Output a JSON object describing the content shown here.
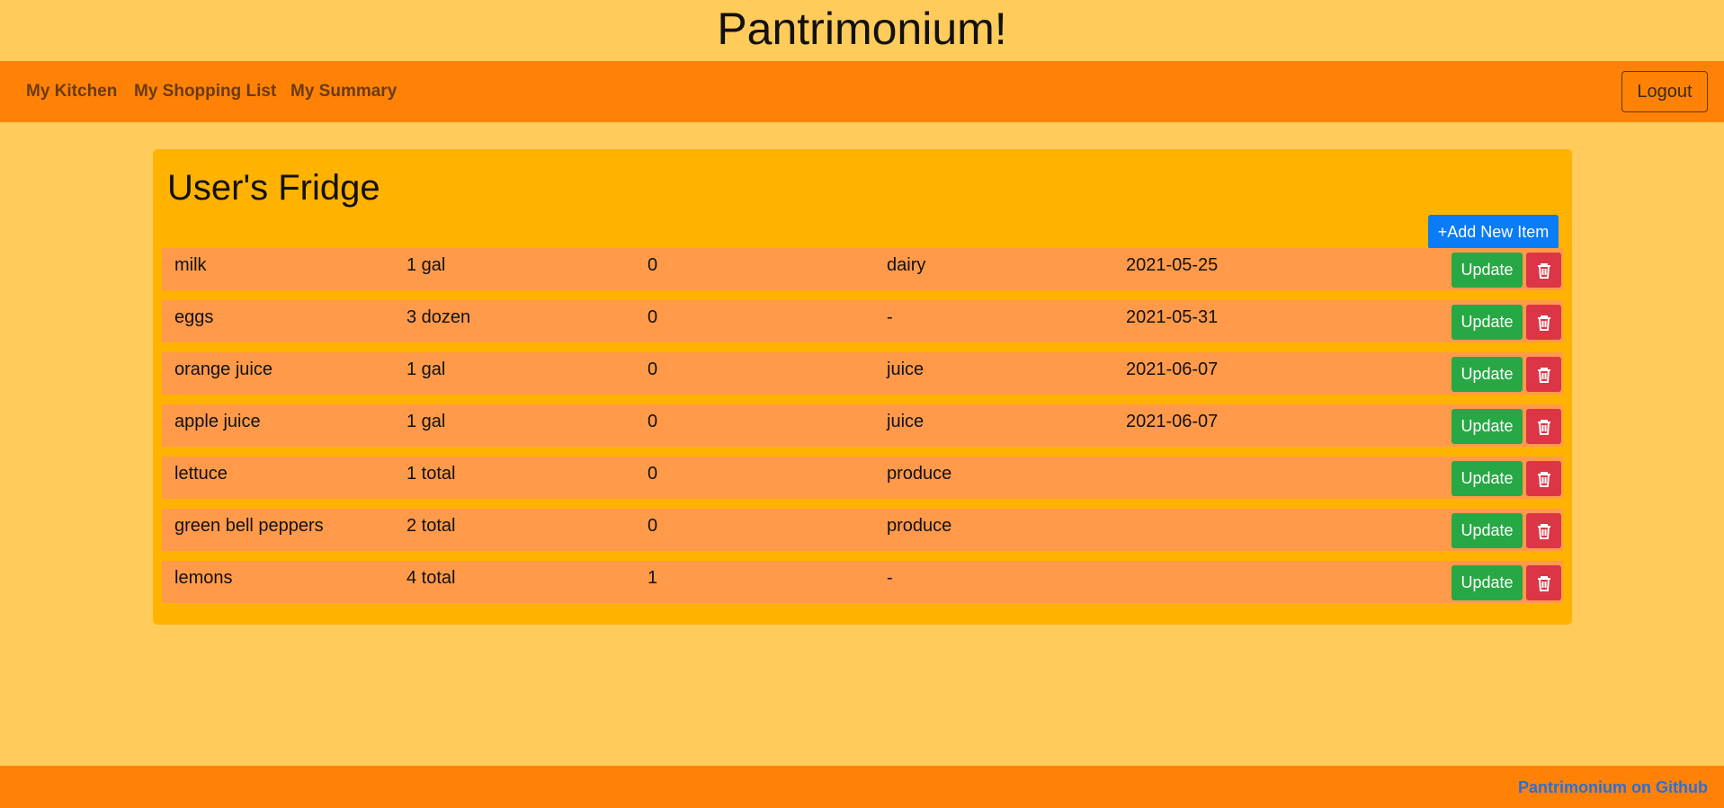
{
  "header": {
    "title": "Pantrimonium!"
  },
  "nav": {
    "links": [
      "My Kitchen",
      "My Shopping List",
      "My Summary"
    ],
    "logout_label": "Logout"
  },
  "fridge": {
    "title": "User's Fridge",
    "add_label": "+Add New Item",
    "update_label": "Update",
    "rows": [
      {
        "name": "milk",
        "quantity": "1 gal",
        "count": "0",
        "category": "dairy",
        "expires": "2021-05-25"
      },
      {
        "name": "eggs",
        "quantity": "3 dozen",
        "count": "0",
        "category": "-",
        "expires": "2021-05-31"
      },
      {
        "name": "orange juice",
        "quantity": "1 gal",
        "count": "0",
        "category": "juice",
        "expires": "2021-06-07"
      },
      {
        "name": "apple juice",
        "quantity": "1 gal",
        "count": "0",
        "category": "juice",
        "expires": "2021-06-07"
      },
      {
        "name": "lettuce",
        "quantity": "1 total",
        "count": "0",
        "category": "produce",
        "expires": ""
      },
      {
        "name": "green bell peppers",
        "quantity": "2 total",
        "count": "0",
        "category": "produce",
        "expires": ""
      },
      {
        "name": "lemons",
        "quantity": "4 total",
        "count": "1",
        "category": "-",
        "expires": ""
      }
    ]
  },
  "footer": {
    "link_label": "Pantrimonium on Github"
  },
  "icons": {
    "delete": "trash-icon"
  },
  "colors": {
    "background": "#ffcb5a",
    "nav": "#ff8206",
    "panel": "#ffb300",
    "row": "#ff9a4a",
    "add_button": "#0a7cf8",
    "update_button": "#28a745",
    "delete_button": "#dc3545"
  }
}
